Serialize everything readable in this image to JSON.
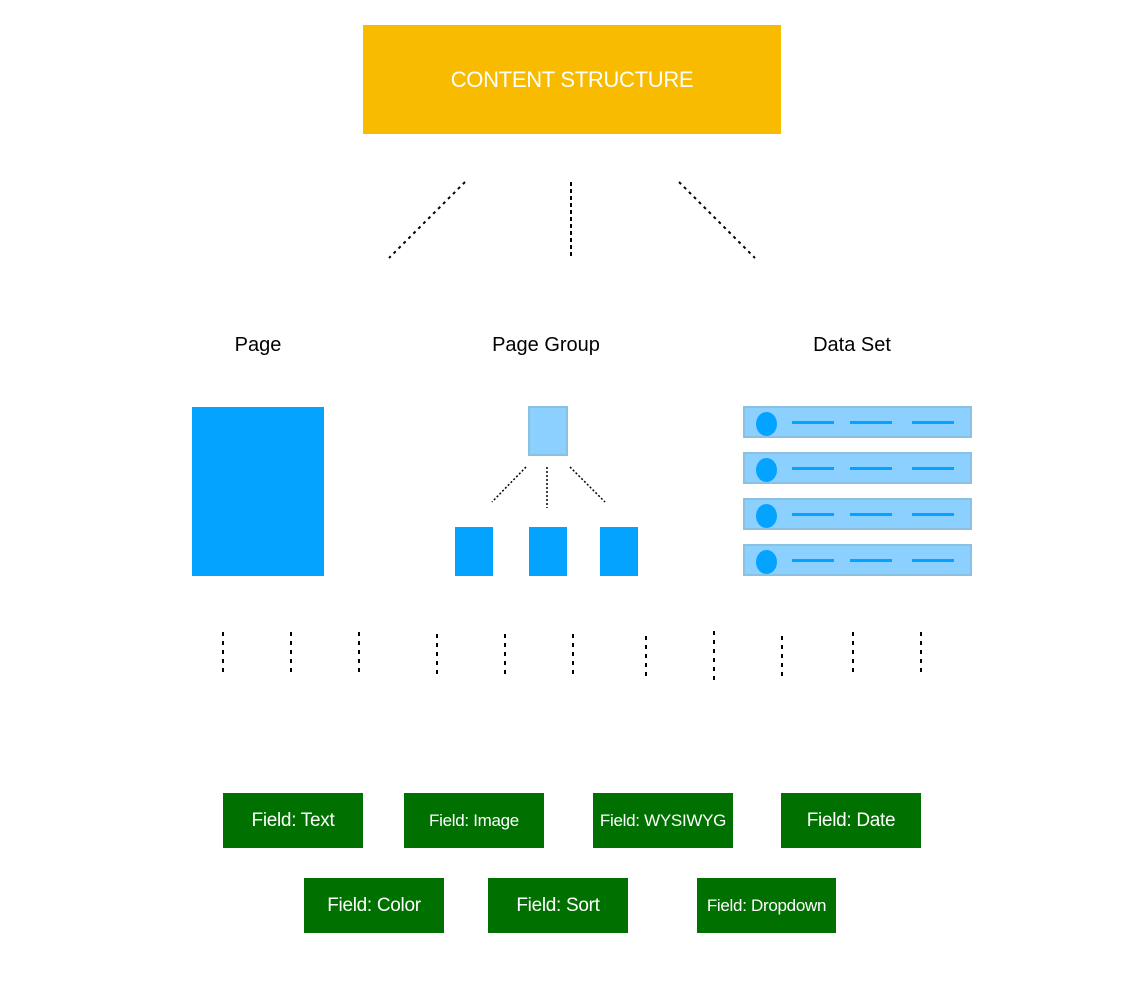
{
  "diagram": {
    "root": {
      "label": "CONTENT STRUCTURE",
      "color": "#F8BB00"
    },
    "types": [
      {
        "label": "Page"
      },
      {
        "label": "Page Group"
      },
      {
        "label": "Data Set"
      }
    ],
    "fields": [
      {
        "label": "Field: Text"
      },
      {
        "label": "Field: Image"
      },
      {
        "label": "Field: WYSIWYG"
      },
      {
        "label": "Field: Date"
      },
      {
        "label": "Field: Color"
      },
      {
        "label": "Field: Sort"
      },
      {
        "label": "Field: Dropdown"
      }
    ],
    "colors": {
      "primary_blue": "#04A3FF",
      "light_blue": "#8BD0FF",
      "field_green": "#007000"
    },
    "data_set_rows": 4,
    "page_group_children": 3
  }
}
